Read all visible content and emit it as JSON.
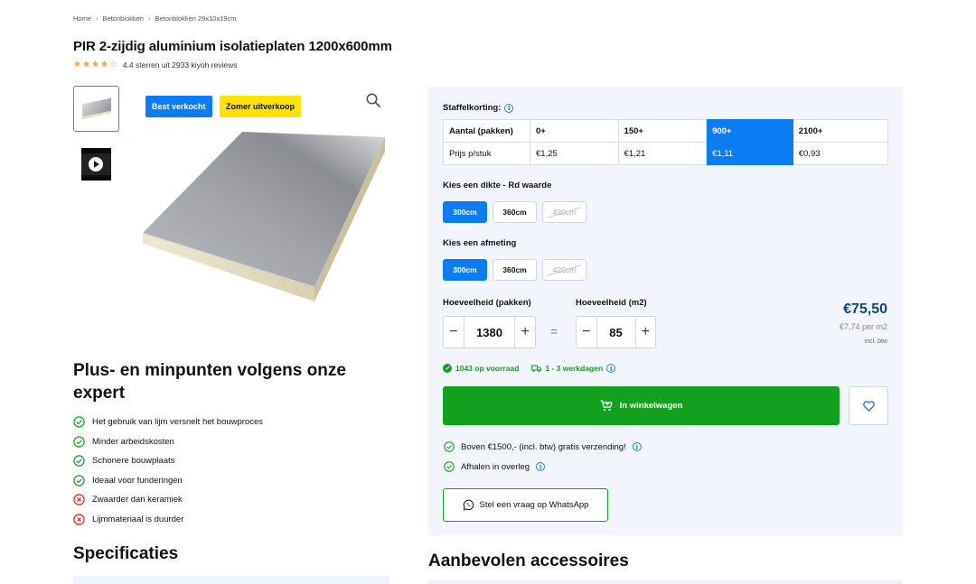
{
  "breadcrumb": [
    "Home",
    "Betonblokken",
    "Betonblokken 29x10x19cm"
  ],
  "product": {
    "title": "PIR 2-zijdig aluminium isolatieplaten 1200x600mm",
    "rating_text": "4.4 sterren uit 2933 kiyoh reviews",
    "rating_value": 4.4,
    "badges": [
      "Best verkocht",
      "Zomer uitverkoop"
    ]
  },
  "pros_cons": {
    "title": "Plus- en minpunten volgens onze expert",
    "items": [
      {
        "type": "plus",
        "text": "Het gebruik van lijm versnelt het bouwproces"
      },
      {
        "type": "plus",
        "text": "Minder arbeidskosten"
      },
      {
        "type": "plus",
        "text": "Schonere bouwplaats"
      },
      {
        "type": "plus",
        "text": "Ideaal voor funderingen"
      },
      {
        "type": "minus",
        "text": "Zwaarder dan keramiek"
      },
      {
        "type": "minus",
        "text": "Lijmmateriaal is duurder"
      }
    ]
  },
  "specs": {
    "title": "Specificaties"
  },
  "staffel": {
    "label": "Staffelkorting:",
    "header_label": "Aantal (pakken)",
    "price_label": "Prijs p/stuk",
    "tiers": [
      "0+",
      "150+",
      "900+",
      "2100+"
    ],
    "prices": [
      "€1,25",
      "€1,21",
      "€1,11",
      "€0,93"
    ],
    "active_index": 2
  },
  "thickness": {
    "label": "Kies een dikte - Rd waarde",
    "options": [
      "300cm",
      "360cm",
      "420cm"
    ]
  },
  "size": {
    "label": "Kies een afmeting",
    "options": [
      "300cm",
      "360cm",
      "420cm"
    ]
  },
  "quantity": {
    "packs_label": "Hoeveelheid (pakken)",
    "packs_value": "1380",
    "m2_label": "Hoeveelheid (m2)",
    "m2_value": "85",
    "equals": "="
  },
  "price": {
    "total": "€75,50",
    "per_m2": "€7,74 per m2",
    "incl": "incl. btw"
  },
  "stock": {
    "available": "1043 op voorraad",
    "delivery": "1 - 3 werkdagen"
  },
  "cart": {
    "label": "In winkelwagen"
  },
  "perks": [
    "Boven €1500,- (incl. btw) gratis verzending!",
    "Afhalen in overleg"
  ],
  "whatsapp": {
    "label": "Stel een vraag op WhatsApp"
  },
  "accessories": {
    "title": "Aanbevolen accessoires"
  },
  "colors": {
    "accent": "#0b7cf1",
    "green": "#14a01f",
    "price": "#13407e",
    "badge_yellow": "#ffe200"
  }
}
